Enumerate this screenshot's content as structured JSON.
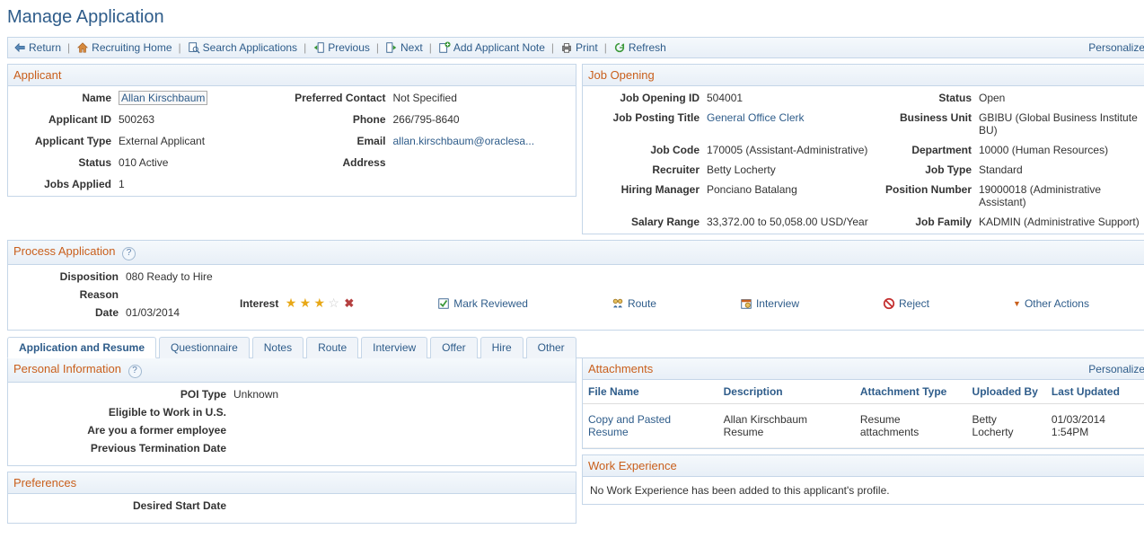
{
  "page": {
    "title": "Manage Application"
  },
  "toolbar": {
    "return": "Return",
    "recruiting_home": "Recruiting Home",
    "search_applications": "Search Applications",
    "previous": "Previous",
    "next": "Next",
    "add_applicant_note": "Add Applicant Note",
    "print": "Print",
    "refresh": "Refresh",
    "personalize": "Personalize"
  },
  "applicant": {
    "header": "Applicant",
    "labels": {
      "name": "Name",
      "applicant_id": "Applicant ID",
      "applicant_type": "Applicant Type",
      "status": "Status",
      "jobs_applied": "Jobs Applied",
      "preferred_contact": "Preferred Contact",
      "phone": "Phone",
      "email": "Email",
      "address": "Address"
    },
    "values": {
      "name": "Allan Kirschbaum",
      "applicant_id": "500263",
      "applicant_type": "External Applicant",
      "status": "010 Active",
      "jobs_applied": "1",
      "preferred_contact": "Not Specified",
      "phone": "266/795-8640",
      "email": "allan.kirschbaum@oraclesa...",
      "address": ""
    }
  },
  "job_opening": {
    "header": "Job Opening",
    "labels": {
      "job_opening_id": "Job Opening ID",
      "job_posting_title": "Job Posting Title",
      "job_code": "Job Code",
      "recruiter": "Recruiter",
      "hiring_manager": "Hiring Manager",
      "salary_range": "Salary Range",
      "status": "Status",
      "business_unit": "Business Unit",
      "department": "Department",
      "job_type": "Job Type",
      "position_number": "Position Number",
      "job_family": "Job Family"
    },
    "values": {
      "job_opening_id": "504001",
      "job_posting_title": "General Office Clerk",
      "job_code": "170005 (Assistant-Administrative)",
      "recruiter": "Betty Locherty",
      "hiring_manager": "Ponciano Batalang",
      "salary_range": "33,372.00 to 50,058.00 USD/Year",
      "status": "Open",
      "business_unit": "GBIBU (Global Business Institute BU)",
      "department": "10000 (Human Resources)",
      "job_type": "Standard",
      "position_number": "19000018 (Administrative Assistant)",
      "job_family": "KADMIN (Administrative Support)"
    }
  },
  "process": {
    "header": "Process Application",
    "labels": {
      "disposition": "Disposition",
      "reason": "Reason",
      "date": "Date",
      "interest": "Interest"
    },
    "values": {
      "disposition": "080 Ready to Hire",
      "reason": "",
      "date": "01/03/2014"
    },
    "actions": {
      "mark_reviewed": "Mark Reviewed",
      "route": "Route",
      "interview": "Interview",
      "reject": "Reject",
      "other_actions": "Other Actions"
    }
  },
  "tabs": {
    "application_and_resume": "Application and Resume",
    "questionnaire": "Questionnaire",
    "notes": "Notes",
    "route": "Route",
    "interview": "Interview",
    "offer": "Offer",
    "hire": "Hire",
    "other": "Other"
  },
  "personal_info": {
    "header": "Personal Information",
    "labels": {
      "poi_type": "POI Type",
      "eligible": "Eligible to Work in U.S.",
      "former": "Are you a former employee",
      "termination": "Previous Termination Date"
    },
    "values": {
      "poi_type": "Unknown",
      "eligible": "",
      "former": "",
      "termination": ""
    }
  },
  "attachments": {
    "header": "Attachments",
    "personalize": "Personalize",
    "columns": {
      "file_name": "File Name",
      "description": "Description",
      "attachment_type": "Attachment Type",
      "uploaded_by": "Uploaded By",
      "last_updated": "Last Updated"
    },
    "rows": [
      {
        "file_name": "Copy and Pasted Resume",
        "description": "Allan Kirschbaum Resume",
        "attachment_type": "Resume attachments",
        "uploaded_by": "Betty Locherty",
        "last_updated": "01/03/2014  1:54PM"
      }
    ]
  },
  "preferences": {
    "header": "Preferences",
    "labels": {
      "desired_start_date": "Desired Start Date"
    },
    "values": {
      "desired_start_date": ""
    }
  },
  "work_experience": {
    "header": "Work Experience",
    "empty_msg": "No Work Experience has been added to this applicant's profile."
  }
}
